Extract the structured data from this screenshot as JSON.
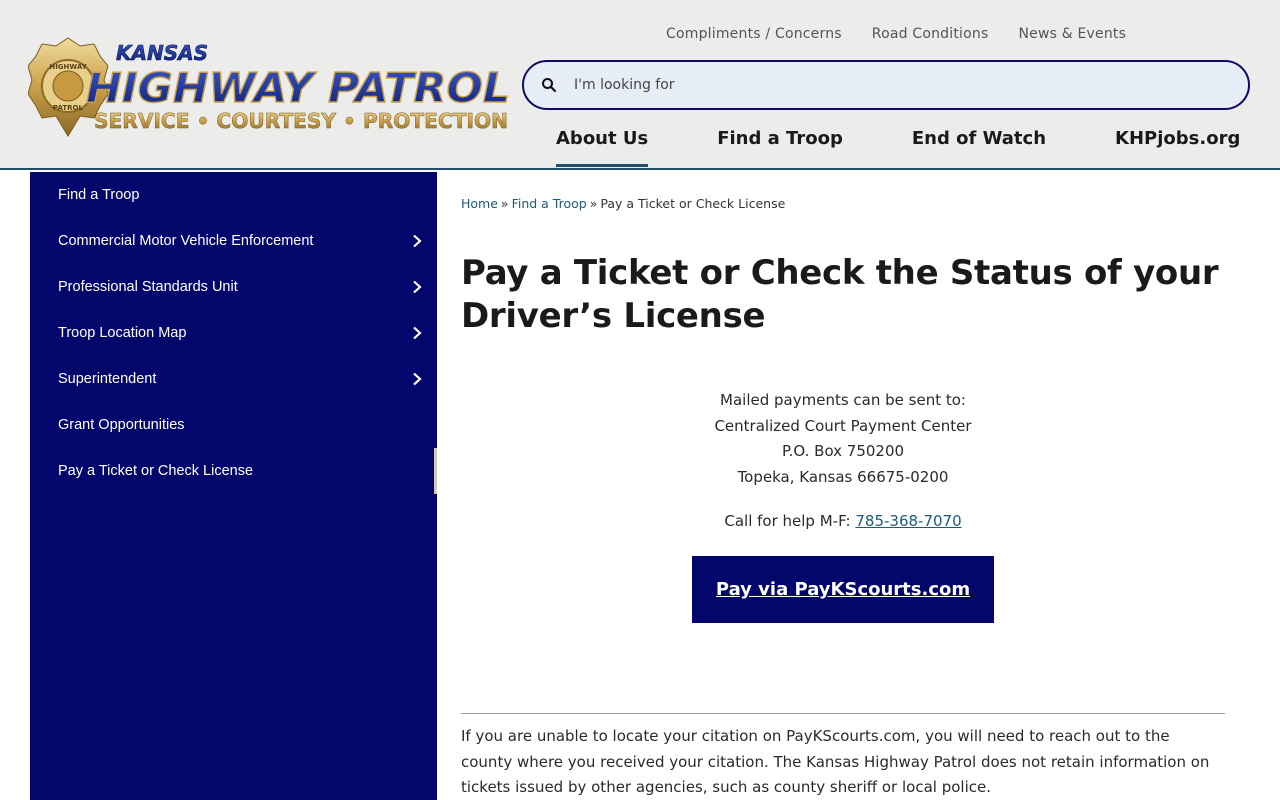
{
  "header": {
    "logo": {
      "top_text": "KANSAS",
      "main_text": "HIGHWAY PATROL",
      "tagline": "SERVICE • COURTESY • PROTECTION",
      "badge_text": "HIGHWAY",
      "badge_bottom": "PATROL",
      "icon": "khp-badge-logo"
    },
    "utility_nav": [
      "Compliments / Concerns",
      "Road Conditions",
      "News & Events"
    ],
    "search": {
      "placeholder": "I'm looking for",
      "icon": "search-icon"
    },
    "main_nav": [
      {
        "label": "About Us",
        "active": true
      },
      {
        "label": "Find a Troop",
        "active": false
      },
      {
        "label": "End of Watch",
        "active": false
      },
      {
        "label": "KHPjobs.org",
        "active": false
      }
    ]
  },
  "sidebar": {
    "items": [
      {
        "label": "Find a Troop",
        "has_children": false
      },
      {
        "label": "Commercial Motor Vehicle Enforcement",
        "has_children": true
      },
      {
        "label": "Professional Standards Unit",
        "has_children": true
      },
      {
        "label": "Troop Location Map",
        "has_children": true
      },
      {
        "label": "Superintendent",
        "has_children": true
      },
      {
        "label": "Grant Opportunities",
        "has_children": false
      },
      {
        "label": "Pay a Ticket or Check License",
        "has_children": false,
        "current": true
      }
    ]
  },
  "breadcrumb": {
    "home": "Home",
    "parent": "Find a Troop",
    "current": "Pay a Ticket or Check License",
    "separator": "»"
  },
  "main": {
    "title": "Pay a Ticket or Check the Status of your Driver’s License",
    "mail_lines": [
      "Mailed payments can be sent to:",
      "Centralized Court Payment Center",
      "P.O. Box 750200",
      "Topeka, Kansas 66675-0200"
    ],
    "call_prefix": "Call for help M-F: ",
    "phone": "785-368-7070",
    "pay_button": "Pay via PayKScourts.com",
    "note": "If you are unable to locate your citation on PayKScourts.com, you will need to reach out to the county where you received your citation.  The Kansas Highway Patrol does not retain information on tickets issued by other agencies, such as county sheriff or local police."
  },
  "colors": {
    "navy": "#03066b",
    "header_bg": "#ececea",
    "link": "#1f5a78",
    "logo_blue": "#1b2f8a",
    "logo_gold": "#c9a04a"
  }
}
